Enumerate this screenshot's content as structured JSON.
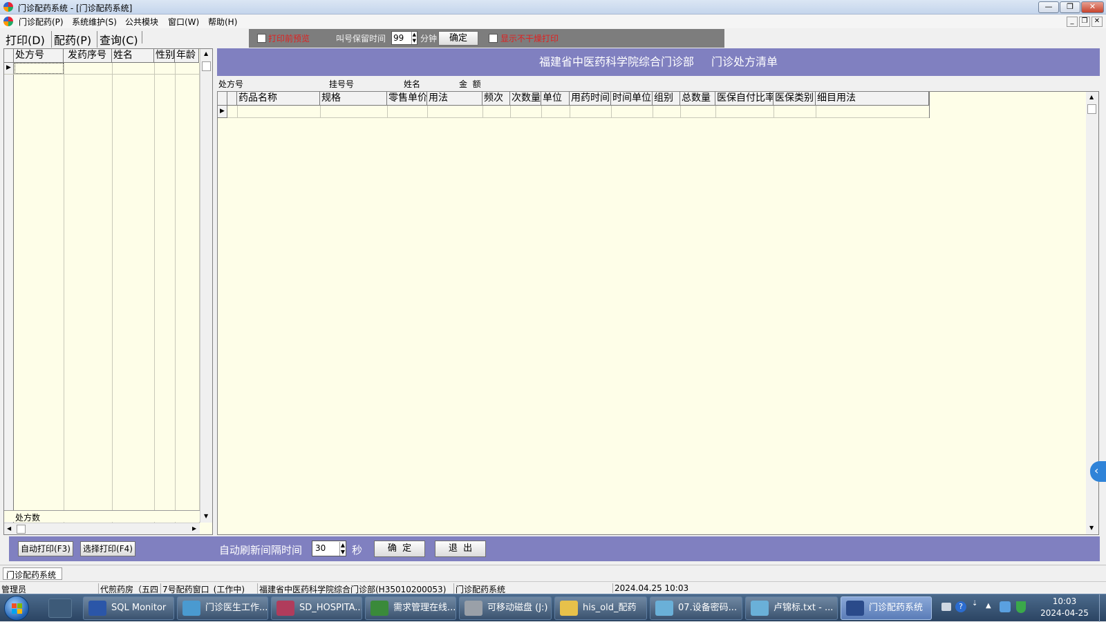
{
  "window": {
    "title": "门诊配药系统 - [门诊配药系统]"
  },
  "menu": [
    "门诊配药(P)",
    "系统维护(S)",
    "公共模块",
    "窗口(W)",
    "帮助(H)"
  ],
  "tabs": [
    "打印(D)",
    "配药(P)",
    "查询(C)"
  ],
  "print_controls": {
    "preview_label": "打印前预览",
    "hold_time_label": "叫号保留时间",
    "hold_time_value": "99",
    "minute_unit": "分钟",
    "confirm": "确定",
    "show_no_dry_label": "显示不干燥打印"
  },
  "left_grid": {
    "columns": [
      "处方号",
      "发药序号",
      "姓名",
      "性别",
      "年龄"
    ],
    "footer_label": "处方数"
  },
  "banner": {
    "hospital": "福建省中医药科学院综合门诊部",
    "title": "门诊处方清单"
  },
  "info_labels": [
    "处方号",
    "挂号号",
    "姓名",
    "金  额"
  ],
  "rx_grid": {
    "columns": [
      "药品名称",
      "规格",
      "零售单价",
      "用法",
      "频次",
      "次数量",
      "单位",
      "用药时间",
      "时间单位",
      "组别",
      "总数量",
      "医保自付比率",
      "医保类别",
      "细目用法"
    ]
  },
  "bottom": {
    "auto_print": "自动打印(F3)",
    "select_print": "选择打印(F4)",
    "refresh_label": "自动刷新间隔时间",
    "refresh_value": "30",
    "second_unit": "秒",
    "confirm": "确  定",
    "exit": "退  出"
  },
  "mdi_tab": "门诊配药系统",
  "status": {
    "user": "管理员",
    "room": "代煎药房（五四",
    "window": "7号配药窗口_(工作中)",
    "org": "福建省中医药科学院综合门诊部(H35010200053)",
    "system": "门诊配药系统",
    "datetime": "2024.04.25 10:03"
  },
  "taskbar": {
    "items": [
      {
        "label": "SQL Monitor",
        "icon": "sql-monitor-icon",
        "color": "#2b56a8"
      },
      {
        "label": "门诊医生工作...",
        "icon": "doctor-station-icon",
        "color": "#4a9ad0"
      },
      {
        "label": "SD_HOSPITA...",
        "icon": "database-icon",
        "color": "#b03c5c"
      },
      {
        "label": "需求管理在线...",
        "icon": "chrome-icon",
        "color": "#3a8a3a"
      },
      {
        "label": "可移动磁盘 (J:)",
        "icon": "drive-icon",
        "color": "#9aa0a8"
      },
      {
        "label": "his_old_配药",
        "icon": "folder-icon",
        "color": "#e7c14a"
      },
      {
        "label": "07.设备密码...",
        "icon": "notepad-icon",
        "color": "#6ab0d8"
      },
      {
        "label": "卢锦标.txt - ...",
        "icon": "notepad-icon",
        "color": "#6ab0d8"
      },
      {
        "label": "门诊配药系统",
        "icon": "laptop-icon",
        "color": "#2a4a8a"
      }
    ],
    "clock_time": "10:03",
    "clock_date": "2024-04-25"
  }
}
